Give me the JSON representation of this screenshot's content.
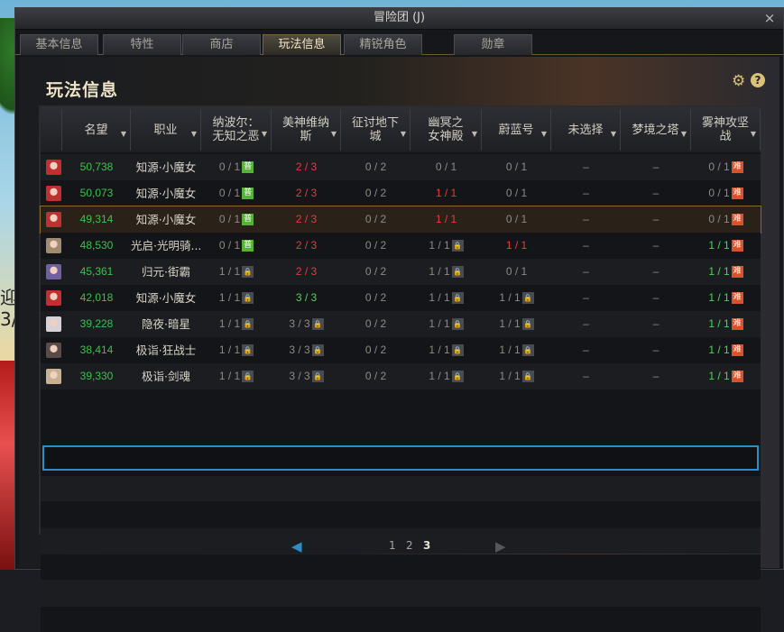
{
  "window": {
    "title": "冒险团 (J)",
    "close": "×"
  },
  "tabs": [
    {
      "label": "基本信息"
    },
    {
      "label": "特性"
    },
    {
      "label": "商店"
    },
    {
      "label": "玩法信息"
    },
    {
      "label": "精锐角色"
    },
    {
      "label": "勋章"
    }
  ],
  "page_title": "玩法信息",
  "icons": {
    "gear": "⚙",
    "help": "?",
    "sort": "▼",
    "lock": "🔒",
    "prev": "◀",
    "next": "▶"
  },
  "columns": [
    {
      "label": ""
    },
    {
      "label": "名望"
    },
    {
      "label": "职业"
    },
    {
      "label": "纳波尔：\n无知之恶"
    },
    {
      "label": "美神维纳\n斯"
    },
    {
      "label": "征讨地下\n城"
    },
    {
      "label": "幽冥之\n女神殿"
    },
    {
      "label": "蔚蓝号"
    },
    {
      "label": "未选择"
    },
    {
      "label": "梦境之塔"
    },
    {
      "label": "雾神攻坚\n战"
    }
  ],
  "badges": {
    "putong": "普",
    "nandu": "难"
  },
  "rows": [
    {
      "rep": "50,738",
      "job": "知源·小魔女",
      "c1": "0 / 1",
      "c1b": "p",
      "c2": "2 / 3",
      "c2s": "red",
      "c3": "0 / 2",
      "c4": "0 / 1",
      "c4s": "gray",
      "c5": "0 / 1",
      "c5s": "gray",
      "c6": "–",
      "c7": "–",
      "c8": "0 / 1",
      "c8s": "gray",
      "av": "#c03030"
    },
    {
      "rep": "50,073",
      "job": "知源·小魔女",
      "c1": "0 / 1",
      "c1b": "p",
      "c2": "2 / 3",
      "c2s": "red",
      "c3": "0 / 2",
      "c4": "1 / 1",
      "c4s": "red",
      "c5": "0 / 1",
      "c5s": "gray",
      "c6": "–",
      "c7": "–",
      "c8": "0 / 1",
      "c8s": "gray",
      "av": "#c03030"
    },
    {
      "rep": "49,314",
      "job": "知源·小魔女",
      "c1": "0 / 1",
      "c1b": "p",
      "c2": "2 / 3",
      "c2s": "red",
      "c3": "0 / 2",
      "c4": "1 / 1",
      "c4s": "red",
      "c5": "0 / 1",
      "c5s": "gray",
      "c6": "–",
      "c7": "–",
      "c8": "0 / 1",
      "c8s": "gray",
      "av": "#c03030",
      "sel": true
    },
    {
      "rep": "48,530",
      "job": "光启·光明骑...",
      "c1": "0 / 1",
      "c1b": "p",
      "c2": "2 / 3",
      "c2s": "red",
      "c3": "0 / 2",
      "c4": "1 / 1",
      "c4s": "lock",
      "c5": "1 / 1",
      "c5s": "red",
      "c6": "–",
      "c7": "–",
      "c8": "1 / 1",
      "c8s": "green",
      "av": "#a08a70"
    },
    {
      "rep": "45,361",
      "job": "归元·街霸",
      "c1": "1 / 1",
      "c1b": "l",
      "c2": "2 / 3",
      "c2s": "red",
      "c3": "0 / 2",
      "c4": "1 / 1",
      "c4s": "lock",
      "c5": "0 / 1",
      "c5s": "gray",
      "c6": "–",
      "c7": "–",
      "c8": "1 / 1",
      "c8s": "green",
      "av": "#7060a0"
    },
    {
      "rep": "42,018",
      "job": "知源·小魔女",
      "c1": "1 / 1",
      "c1b": "l",
      "c2": "3 / 3",
      "c2s": "green",
      "c3": "0 / 2",
      "c4": "1 / 1",
      "c4s": "lock",
      "c5": "1 / 1",
      "c5s": "lock",
      "c6": "–",
      "c7": "–",
      "c8": "1 / 1",
      "c8s": "green",
      "av": "#c03030"
    },
    {
      "rep": "39,228",
      "job": "隐夜·暗星",
      "c1": "1 / 1",
      "c1b": "l",
      "c2": "3 / 3",
      "c2s": "lock",
      "c3": "0 / 2",
      "c4": "1 / 1",
      "c4s": "lock",
      "c5": "1 / 1",
      "c5s": "lock",
      "c6": "–",
      "c7": "–",
      "c8": "1 / 1",
      "c8s": "green",
      "av": "#d8d0d8"
    },
    {
      "rep": "38,414",
      "job": "极诣·狂战士",
      "c1": "1 / 1",
      "c1b": "l",
      "c2": "3 / 3",
      "c2s": "lock",
      "c3": "0 / 2",
      "c4": "1 / 1",
      "c4s": "lock",
      "c5": "1 / 1",
      "c5s": "lock",
      "c6": "–",
      "c7": "–",
      "c8": "1 / 1",
      "c8s": "green",
      "av": "#5a4a48"
    },
    {
      "rep": "39,330",
      "job": "极诣·剑魂",
      "c1": "1 / 1",
      "c1b": "l",
      "c2": "3 / 3",
      "c2s": "lock",
      "c3": "0 / 2",
      "c4": "1 / 1",
      "c4s": "lock",
      "c5": "1 / 1",
      "c5s": "lock",
      "c6": "–",
      "c7": "–",
      "c8": "1 / 1",
      "c8s": "green",
      "av": "#c8b090"
    }
  ],
  "pager": {
    "pages": [
      "1",
      "2",
      "3"
    ],
    "current": "3"
  },
  "background": {
    "side_text": "迎 3/"
  }
}
